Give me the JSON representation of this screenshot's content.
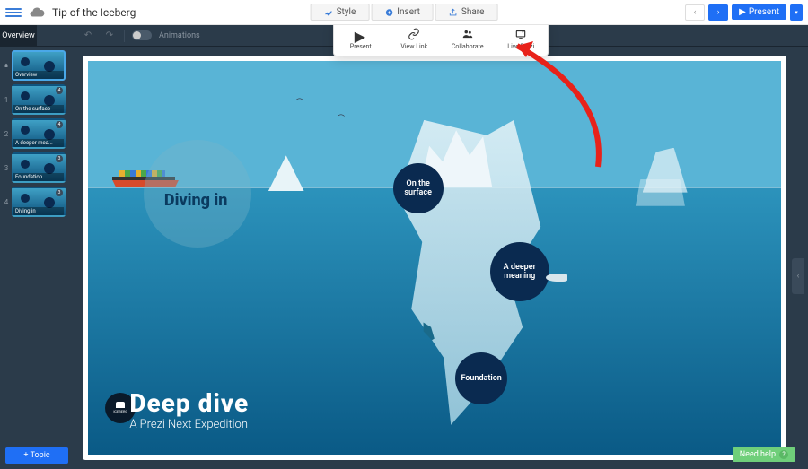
{
  "topbar": {
    "title": "Tip of the Iceberg",
    "style_label": "Style",
    "insert_label": "Insert",
    "share_label": "Share",
    "present_label": "Present"
  },
  "share_menu": {
    "present": "Present",
    "view_link": "View Link",
    "collaborate": "Collaborate",
    "live_prezi": "Live Prezi"
  },
  "sidebar": {
    "tab_overview": "Overview",
    "add_topic": "+ Topic",
    "thumbs": [
      {
        "num": "",
        "label": "Overview",
        "active": true,
        "badge": ""
      },
      {
        "num": "1",
        "label": "On the surface",
        "active": false,
        "badge": "4"
      },
      {
        "num": "2",
        "label": "A deeper mea...",
        "active": false,
        "badge": "4"
      },
      {
        "num": "3",
        "label": "Foundation",
        "active": false,
        "badge": "3"
      },
      {
        "num": "4",
        "label": "Diving in",
        "active": false,
        "badge": "3"
      }
    ]
  },
  "toolbar2": {
    "animations": "Animations"
  },
  "canvas": {
    "diving_in": "Diving in",
    "surface": "On the surface",
    "deeper": "A deeper meaning",
    "foundation": "Foundation",
    "title": "Deep dive",
    "subtitle": "A Prezi Next Expedition",
    "logo_text": "ICEBERG"
  },
  "footer": {
    "need_help": "Need help"
  }
}
